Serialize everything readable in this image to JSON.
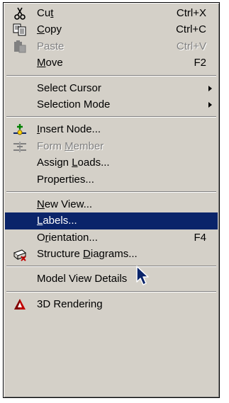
{
  "menu": {
    "items": [
      {
        "type": "item",
        "id": "cut",
        "icon": "scissors-icon",
        "pre": "Cu",
        "acc": "t",
        "post": "",
        "shortcut": "Ctrl+X",
        "disabled": false
      },
      {
        "type": "item",
        "id": "copy",
        "icon": "copy-icon",
        "pre": "",
        "acc": "C",
        "post": "opy",
        "shortcut": "Ctrl+C",
        "disabled": false
      },
      {
        "type": "item",
        "id": "paste",
        "icon": "paste-icon",
        "pre": "Paste",
        "acc": "",
        "post": "",
        "shortcut": "Ctrl+V",
        "disabled": true
      },
      {
        "type": "item",
        "id": "move",
        "icon": "",
        "pre": "",
        "acc": "M",
        "post": "ove",
        "shortcut": "F2",
        "disabled": false
      },
      {
        "type": "sep"
      },
      {
        "type": "item",
        "id": "select-cursor",
        "icon": "",
        "pre": "Select Cursor",
        "acc": "",
        "post": "",
        "shortcut": "",
        "submenu": true,
        "disabled": false
      },
      {
        "type": "item",
        "id": "selection-mode",
        "icon": "",
        "pre": "Selection Mode",
        "acc": "",
        "post": "",
        "shortcut": "",
        "submenu": true,
        "disabled": false
      },
      {
        "type": "sep"
      },
      {
        "type": "item",
        "id": "insert-node",
        "icon": "insert-node-icon",
        "pre": "",
        "acc": "I",
        "post": "nsert Node...",
        "shortcut": "",
        "disabled": false
      },
      {
        "type": "item",
        "id": "form-member",
        "icon": "form-member-icon",
        "pre": "Form ",
        "acc": "M",
        "post": "ember",
        "shortcut": "",
        "disabled": true
      },
      {
        "type": "item",
        "id": "assign-loads",
        "icon": "",
        "pre": "Assign ",
        "acc": "L",
        "post": "oads...",
        "shortcut": "",
        "disabled": false
      },
      {
        "type": "item",
        "id": "properties",
        "icon": "",
        "pre": "Properties...",
        "acc": "",
        "post": "",
        "shortcut": "",
        "disabled": false
      },
      {
        "type": "sep"
      },
      {
        "type": "item",
        "id": "new-view",
        "icon": "",
        "pre": "",
        "acc": "N",
        "post": "ew View...",
        "shortcut": "",
        "disabled": false
      },
      {
        "type": "item",
        "id": "labels",
        "icon": "",
        "pre": "",
        "acc": "L",
        "post": "abels...",
        "shortcut": "",
        "disabled": false,
        "selected": true
      },
      {
        "type": "item",
        "id": "orientation",
        "icon": "",
        "pre": "O",
        "acc": "r",
        "post": "ientation...",
        "shortcut": "F4",
        "disabled": false
      },
      {
        "type": "item",
        "id": "structure-diagrams",
        "icon": "structure-diagrams-icon",
        "pre": "Structure ",
        "acc": "D",
        "post": "iagrams...",
        "shortcut": "",
        "disabled": false
      },
      {
        "type": "sep"
      },
      {
        "type": "item",
        "id": "model-view-details",
        "icon": "",
        "pre": "Model View Details",
        "acc": "",
        "post": "",
        "shortcut": "",
        "disabled": false
      },
      {
        "type": "sep"
      },
      {
        "type": "item",
        "id": "3d-rendering",
        "icon": "3d-rendering-icon",
        "pre": "3D Rendering",
        "acc": "",
        "post": "",
        "shortcut": "",
        "disabled": false
      }
    ]
  },
  "cursor_icon": "mouse-pointer-icon",
  "colors": {
    "menu_bg": "#d4d0c8",
    "highlight": "#0a246a",
    "disabled_text": "#808080"
  }
}
